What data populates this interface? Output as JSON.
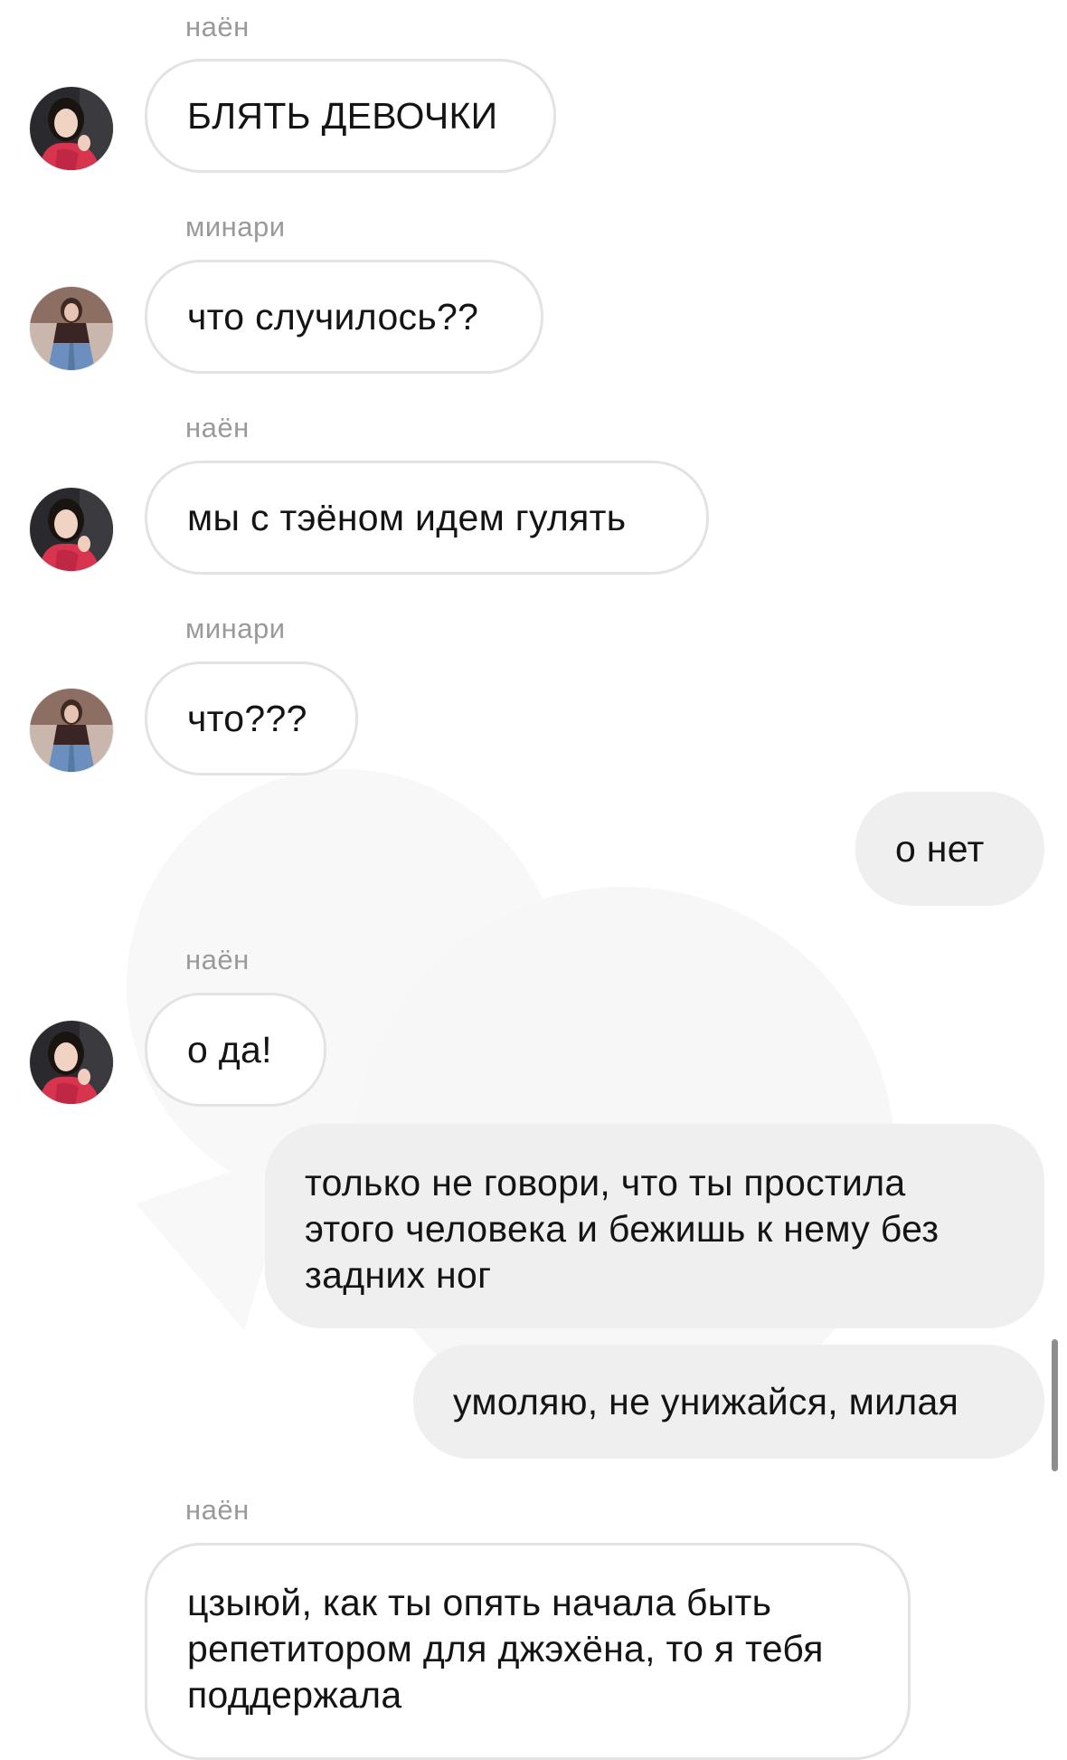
{
  "colors": {
    "background": "#ffffff",
    "incoming_bubble_border": "#e3e3e3",
    "outgoing_bubble_fill": "#efeff0",
    "sender_name": "#9a9a9a",
    "text": "#141414"
  },
  "messages": [
    {
      "sender": "наён",
      "avatar": "avatar-nayeon",
      "text": "БЛЯТЬ ДЕВОЧКИ"
    },
    {
      "sender": "минари",
      "avatar": "avatar-minari",
      "text": "что случилось??"
    },
    {
      "sender": "наён",
      "avatar": "avatar-nayeon",
      "text": "мы с тэёном идем гулять"
    },
    {
      "sender": "минари",
      "avatar": "avatar-minari",
      "text": "что???"
    },
    {
      "sender": "",
      "text": "о нет"
    },
    {
      "sender": "наён",
      "avatar": "avatar-nayeon",
      "text": "о да!"
    },
    {
      "sender": "",
      "text": "только не говори, что ты простила этого человека и бежишь к нему без задних ног"
    },
    {
      "sender": "",
      "text": "умоляю, не унижайся, милая"
    },
    {
      "sender": "наён",
      "avatar": "avatar-nayeon",
      "text": "цзыюй, как ты опять начала быть репетитором для джэхёна, то я тебя поддержала"
    }
  ]
}
